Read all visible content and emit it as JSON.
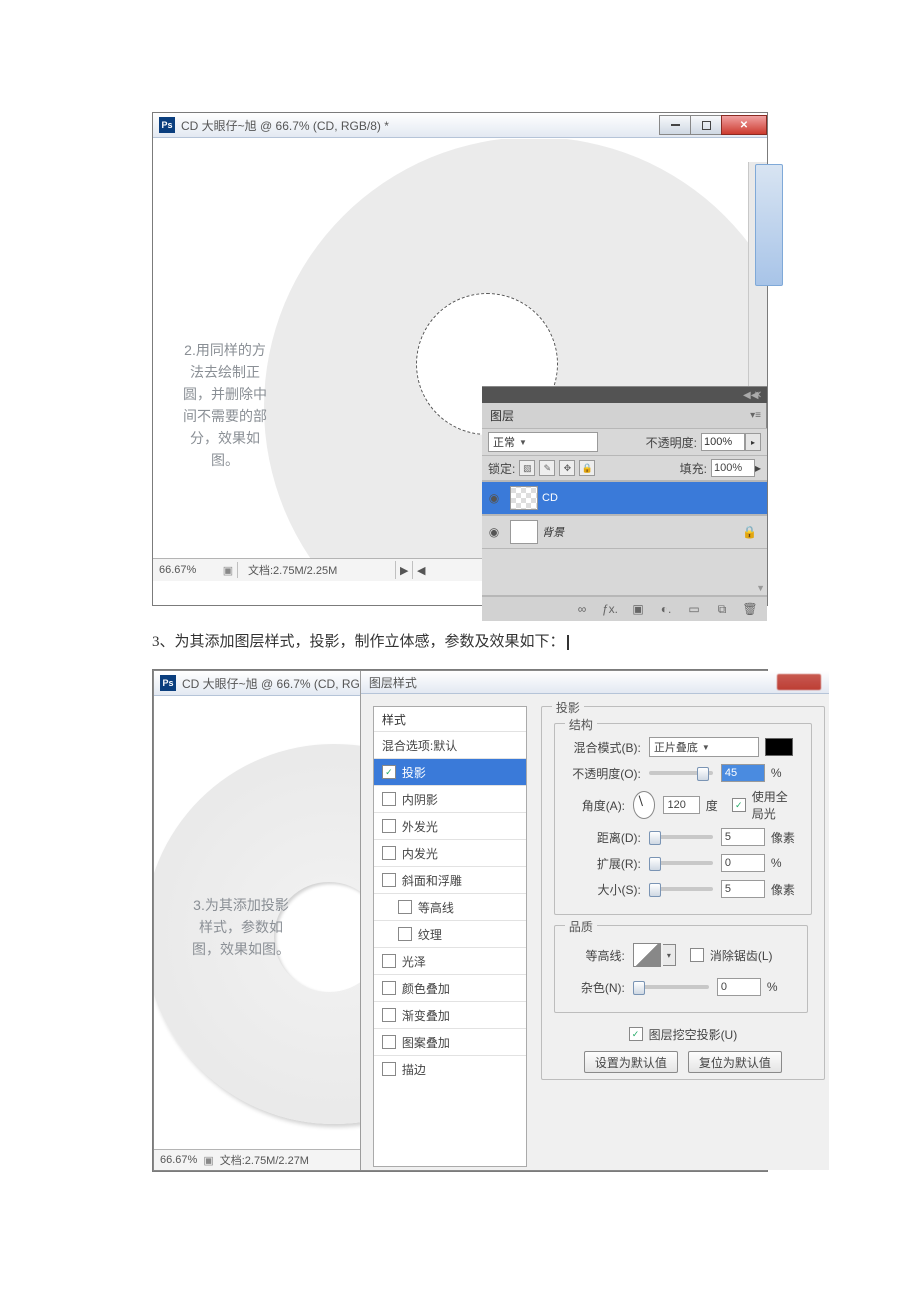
{
  "fig1": {
    "title": "CD 大眼仔~旭 @ 66.7% (CD, RGB/8) *",
    "annotation": "2.用同样的方法去绘制正圆，并删除中间不需要的部分，效果如图。",
    "zoom": "66.67%",
    "docsize": "文档:2.75M/2.25M",
    "layers": {
      "tab": "图层",
      "blend_mode": "正常",
      "opacity_label": "不透明度:",
      "opacity_value": "100%",
      "lock_label": "锁定:",
      "fill_label": "填充:",
      "fill_value": "100%",
      "rows": [
        {
          "name": "CD"
        },
        {
          "name": "背景"
        }
      ],
      "footer_icons": [
        "∞",
        "ƒx.",
        "▣",
        "◐.",
        "▭",
        "⧉",
        "🗑"
      ]
    }
  },
  "caption": "3、为其添加图层样式，投影，制作立体感，参数及效果如下：",
  "fig2": {
    "title_left": "CD 大眼仔~旭 @ 66.7% (CD, RG",
    "annotation": "3.为其添加投影样式，参数如图，效果如图。",
    "zoom": "66.67%",
    "docsize": "文档:2.75M/2.27M",
    "dialog_title": "图层样式",
    "styles_header": "样式",
    "styles": [
      {
        "label": "混合选项:默认",
        "chk": null
      },
      {
        "label": "投影",
        "chk": true,
        "sel": true
      },
      {
        "label": "内阴影",
        "chk": false
      },
      {
        "label": "外发光",
        "chk": false
      },
      {
        "label": "内发光",
        "chk": false
      },
      {
        "label": "斜面和浮雕",
        "chk": false
      },
      {
        "label": "等高线",
        "chk": false,
        "sub": true
      },
      {
        "label": "纹理",
        "chk": false,
        "sub": true
      },
      {
        "label": "光泽",
        "chk": false
      },
      {
        "label": "颜色叠加",
        "chk": false
      },
      {
        "label": "渐变叠加",
        "chk": false
      },
      {
        "label": "图案叠加",
        "chk": false
      },
      {
        "label": "描边",
        "chk": false
      }
    ],
    "shadow": {
      "group1": "投影",
      "group_struct": "结构",
      "blend_label": "混合模式(B):",
      "blend_value": "正片叠底",
      "opacity_label": "不透明度(O):",
      "opacity_value": "45",
      "opacity_unit": "%",
      "angle_label": "角度(A):",
      "angle_value": "120",
      "angle_unit": "度",
      "global_label": "使用全局光",
      "dist_label": "距离(D):",
      "dist_value": "5",
      "dist_unit": "像素",
      "spread_label": "扩展(R):",
      "spread_value": "0",
      "spread_unit": "%",
      "size_label": "大小(S):",
      "size_value": "5",
      "size_unit": "像素",
      "group_quality": "品质",
      "contour_label": "等高线:",
      "antialias_label": "消除锯齿(L)",
      "noise_label": "杂色(N):",
      "noise_value": "0",
      "noise_unit": "%",
      "knockout_label": "图层挖空投影(U)",
      "btn_default": "设置为默认值",
      "btn_reset": "复位为默认值"
    }
  }
}
